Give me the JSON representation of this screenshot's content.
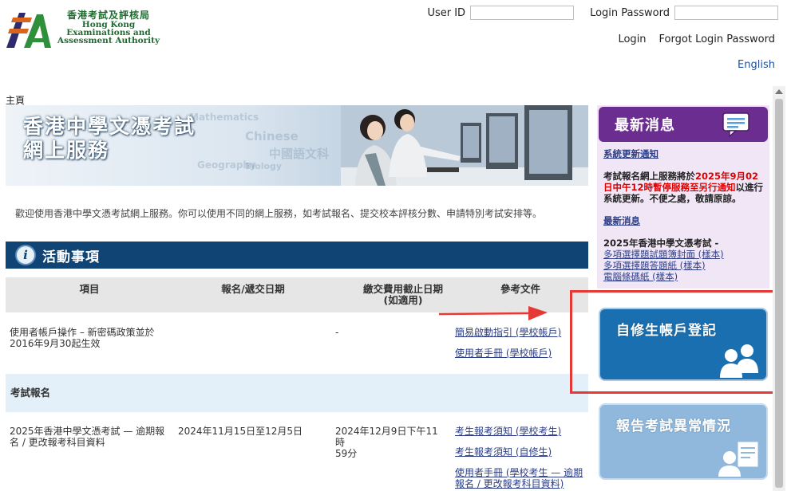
{
  "header": {
    "logo_zh": "香港考試及評核局",
    "logo_en_1": "Hong Kong",
    "logo_en_2": "Examinations and",
    "logo_en_3": "Assessment Authority",
    "user_id_label": "User ID",
    "password_label": "Login Password",
    "user_id_value": "",
    "password_value": "",
    "login_link": "Login",
    "forgot_link": "Forgot Login Password",
    "language_link": "English"
  },
  "breadcrumb": "主頁",
  "banner": {
    "title_line1": "香港中學文憑考試",
    "title_line2": "網上服務",
    "bg_words": [
      "Chinese",
      "中國語文科",
      "Biology",
      "Geography",
      "Mathematics"
    ]
  },
  "welcome_text": "歡迎使用香港中學文憑考試網上服務。你可以使用不同的網上服務，如考試報名、提交校本評核分數、申請特別考試安排等。",
  "activities": {
    "title": "活動事項",
    "columns": {
      "item": "項目",
      "dates": "報名/遞交日期",
      "fee_deadline_1": "繳交費用截止日期",
      "fee_deadline_2": "(如適用)",
      "docs": "參考文件"
    },
    "row1": {
      "item_1": "使用者帳戶操作 – 新密碼政策並於",
      "item_2": "2016年9月30起生效",
      "dates": "",
      "fee": "-",
      "doc1": "簡易啟動指引 (學校帳戶)",
      "doc2": "使用者手冊 (學校帳戶)"
    },
    "category": "考試報名",
    "row2": {
      "item_1": "2025年香港中學文憑考試 — 逾期報",
      "item_2": "名 / 更改報考科目資料",
      "dates": "2024年11月15日至12月5日",
      "fee_1": "2024年12月9日下午11時",
      "fee_2": "59分",
      "doc1": "考生報考須知 (學校考生)",
      "doc2": "考生報考須知 (自修生)",
      "doc3_1": "使用者手冊 (學校考生 — 逾期",
      "doc3_2": "報名 / 更改報考科目資料)"
    }
  },
  "news": {
    "title": "最新消息",
    "system_update_link": "系統更新通知",
    "notice_part1": "考試報名網上服務將於",
    "notice_red": "2025年9月02日中午12時暫停服務至另行通知",
    "notice_part2": "以進行系統更新。不便之處，敬請原諒。",
    "latest_link": "最新消息",
    "exam_heading": "2025年香港中學文憑考試 -",
    "link1": "多項選擇題試題簿封面 (樣本)",
    "link2": "多項選擇題答題紙 (樣本)",
    "link3": "電腦條碼紙 (樣本)"
  },
  "tiles": {
    "self_register": "自修生帳戶登記",
    "report_irregularity": "報告考試異常情況"
  },
  "colors": {
    "navy": "#0f4474",
    "purple": "#6c2d91",
    "tile_blue": "#1a6fb0",
    "tile_light": "#8fb8dc",
    "annotation_red": "#e53935",
    "news_red": "#e10000"
  }
}
